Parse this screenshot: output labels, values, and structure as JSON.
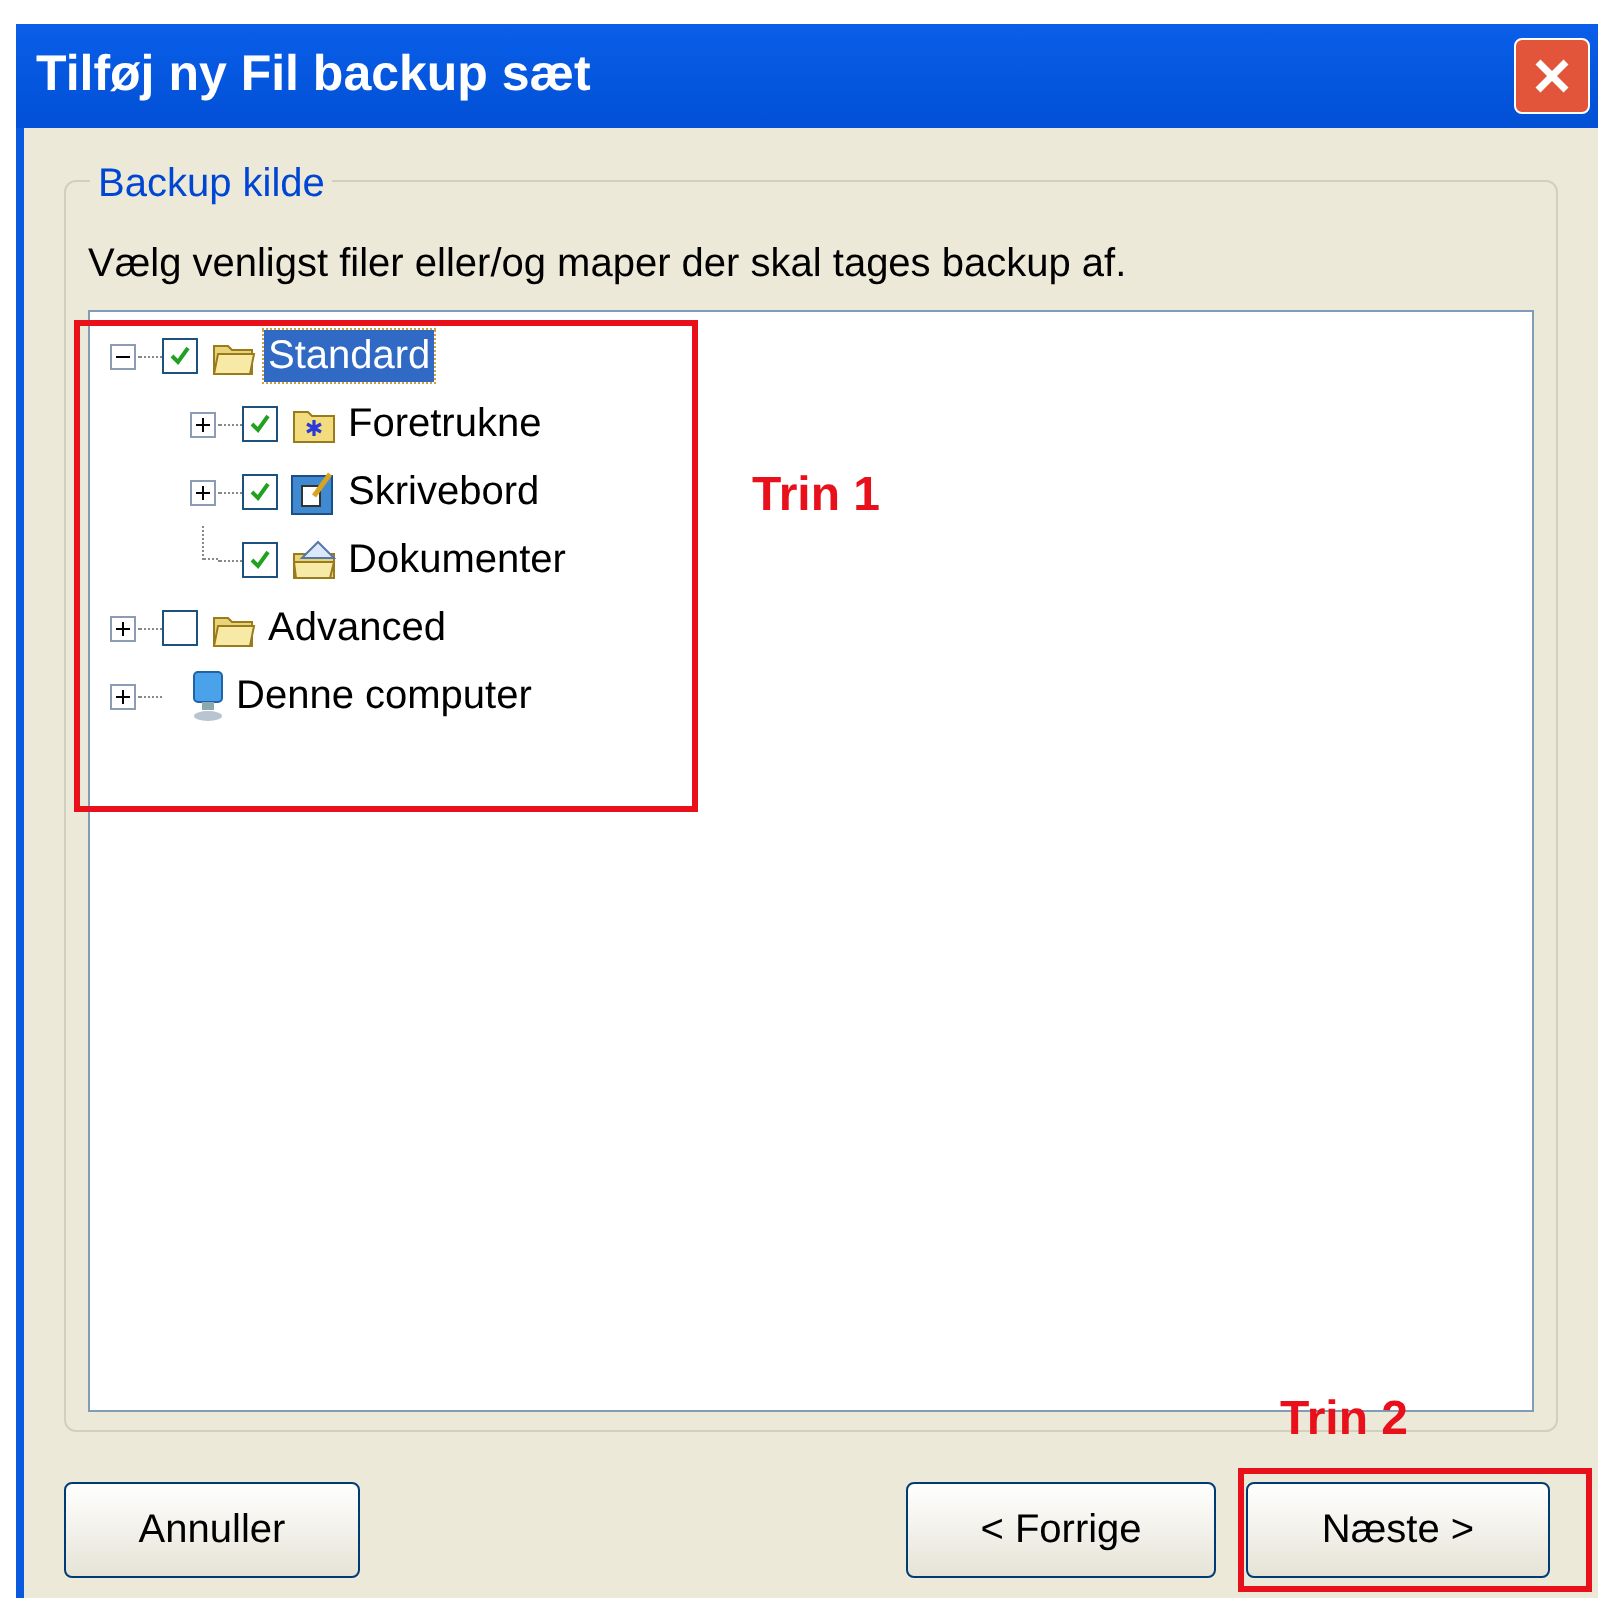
{
  "window": {
    "title": "Tilføj ny Fil backup sæt"
  },
  "group": {
    "title": "Backup kilde",
    "instruction": "Vælg venligst filer eller/og maper der skal tages backup af."
  },
  "tree": [
    {
      "label": "Standard",
      "kind": "folder",
      "expandable": true,
      "expanded": true,
      "has_checkbox": true,
      "checked": true,
      "selected": true,
      "children": [
        {
          "label": "Foretrukne",
          "kind": "favorites",
          "expandable": true,
          "expanded": false,
          "has_checkbox": true,
          "checked": true,
          "selected": false
        },
        {
          "label": "Skrivebord",
          "kind": "desktop",
          "expandable": true,
          "expanded": false,
          "has_checkbox": true,
          "checked": true,
          "selected": false
        },
        {
          "label": "Dokumenter",
          "kind": "documents",
          "expandable": false,
          "has_checkbox": true,
          "checked": true,
          "selected": false
        }
      ]
    },
    {
      "label": "Advanced",
      "kind": "folder",
      "expandable": true,
      "expanded": false,
      "has_checkbox": true,
      "checked": false,
      "selected": false
    },
    {
      "label": "Denne computer",
      "kind": "computer",
      "expandable": true,
      "expanded": false,
      "has_checkbox": false,
      "selected": false
    }
  ],
  "buttons": {
    "cancel": "Annuller",
    "back": "< Forrige",
    "next": "Næste >"
  },
  "annotations": [
    {
      "label": "Trin 1"
    },
    {
      "label": "Trin 2"
    }
  ]
}
